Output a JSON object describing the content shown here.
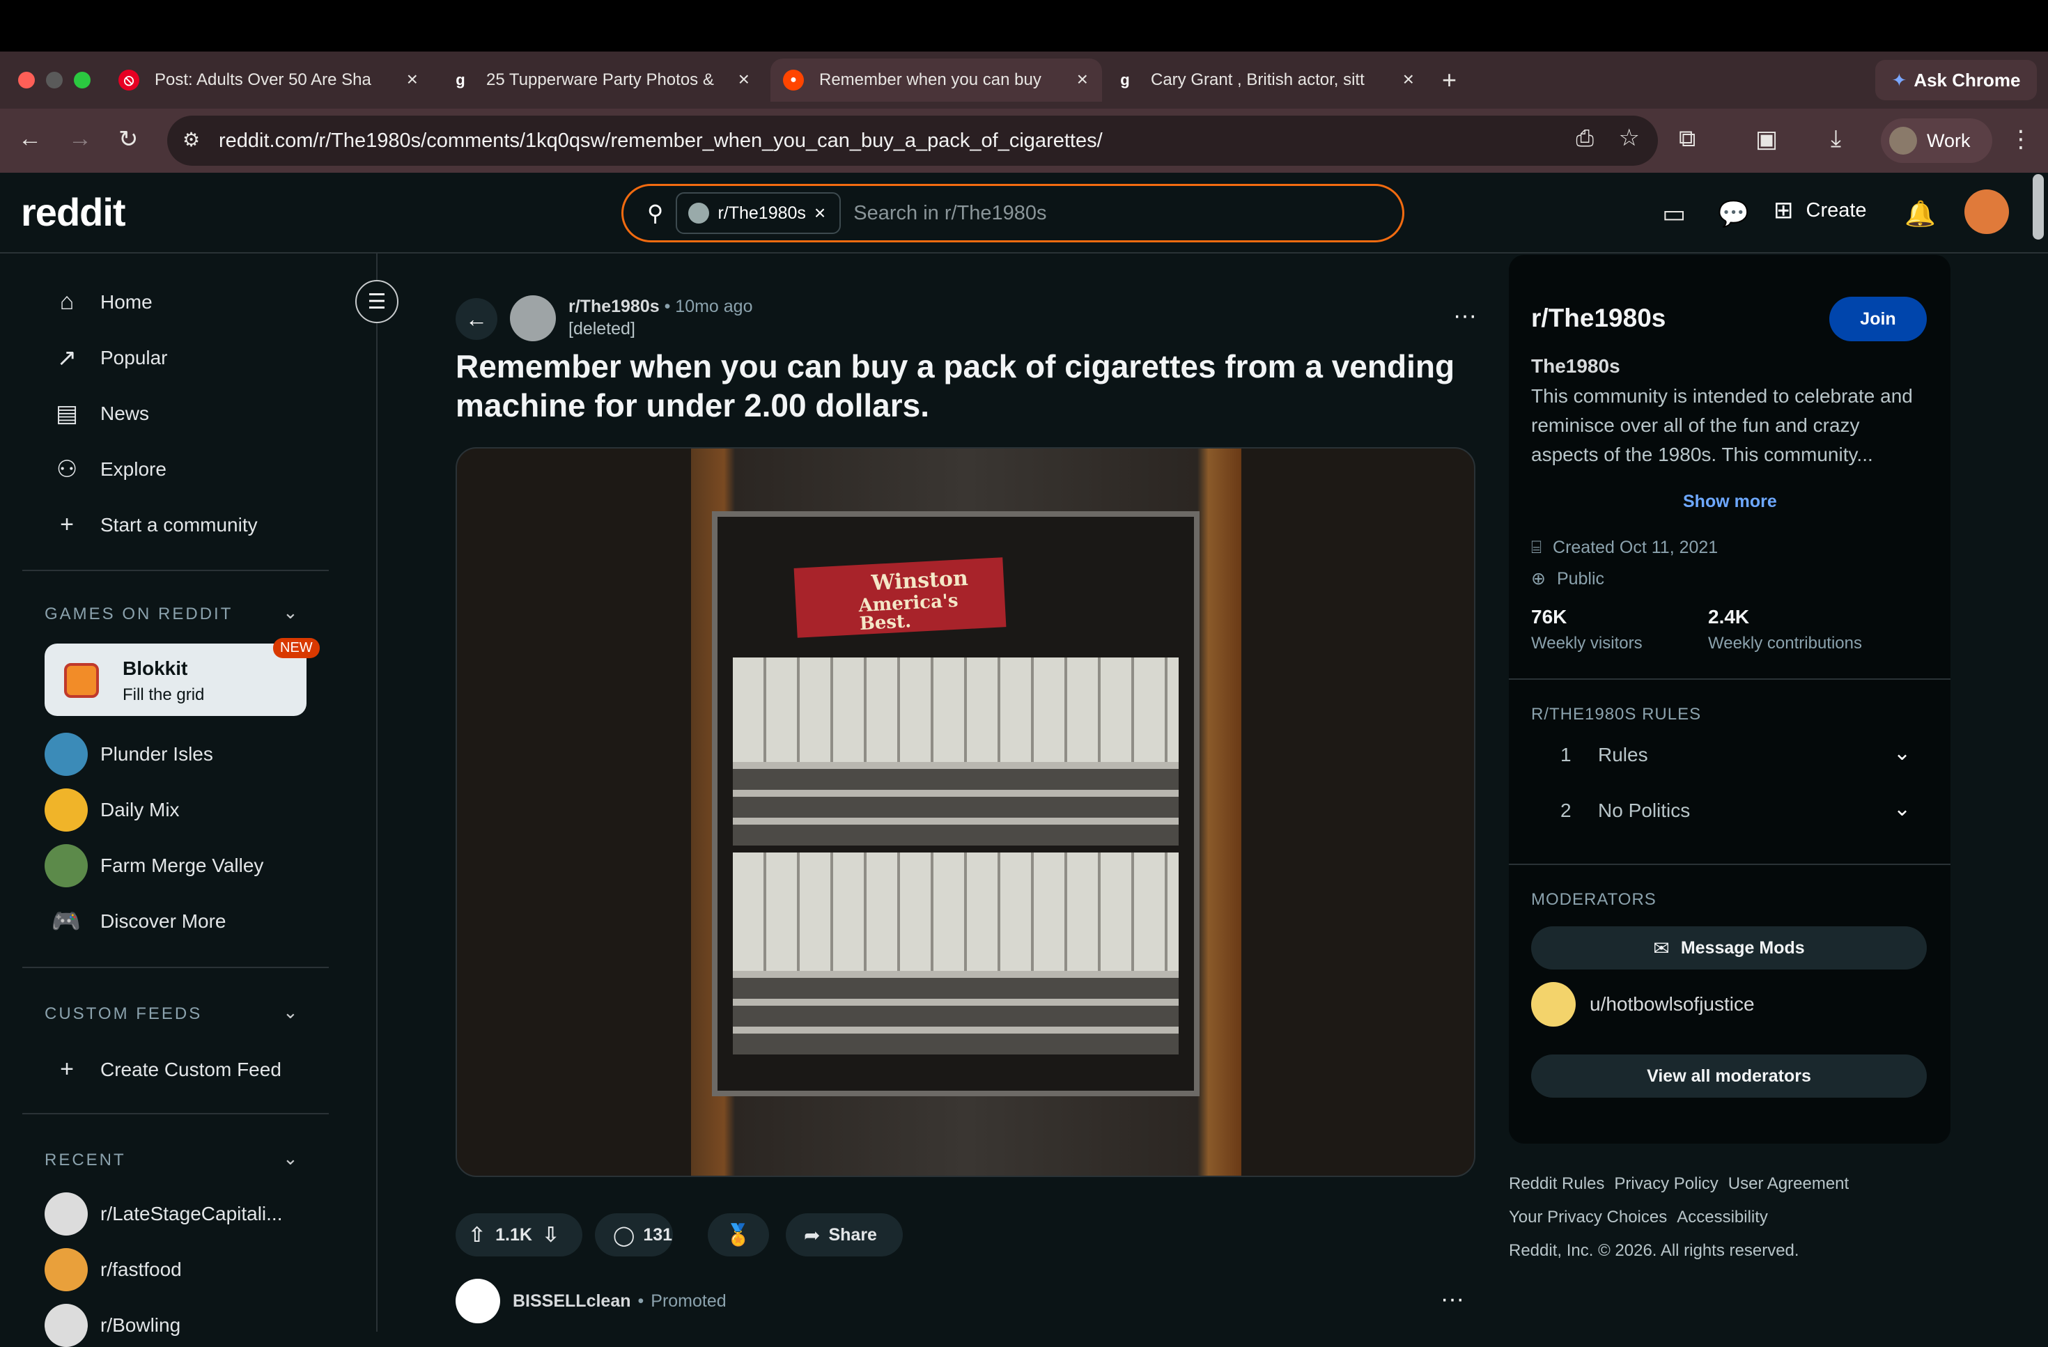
{
  "browser": {
    "tabs": [
      {
        "title": "Post: Adults Over 50 Are Sha",
        "favicon": "pinterest-icon"
      },
      {
        "title": "25 Tupperware Party Photos &",
        "favicon": "g-icon"
      },
      {
        "title": "Remember when you can buy",
        "favicon": "reddit-icon"
      },
      {
        "title": "Cary Grant , British actor, sitt",
        "favicon": "g-icon"
      }
    ],
    "new_tab": "+",
    "ask_chrome": "Ask Chrome",
    "url": "reddit.com/r/The1980s/comments/1kq0qsw/remember_when_you_can_buy_a_pack_of_cigarettes/",
    "profile": "Work"
  },
  "header": {
    "logo": "reddit",
    "search_chip": "r/The1980s",
    "search_placeholder": "Search in r/The1980s",
    "create": "Create"
  },
  "sidebar": {
    "nav": [
      {
        "label": "Home",
        "icon": "home-icon",
        "glyph": "⌂"
      },
      {
        "label": "Popular",
        "icon": "popular-icon",
        "glyph": "↗"
      },
      {
        "label": "News",
        "icon": "news-icon",
        "glyph": "▤"
      },
      {
        "label": "Explore",
        "icon": "explore-icon",
        "glyph": "⚇"
      },
      {
        "label": "Start a community",
        "icon": "plus-icon",
        "glyph": "+"
      }
    ],
    "games_header": "GAMES ON REDDIT",
    "blokkit": {
      "title": "Blokkit",
      "subtitle": "Fill the grid",
      "badge": "NEW"
    },
    "games": [
      "Plunder Isles",
      "Daily Mix",
      "Farm Merge Valley",
      "Discover More"
    ],
    "custom_header": "CUSTOM FEEDS",
    "create_feed": "Create Custom Feed",
    "recent_header": "RECENT",
    "recent": [
      "r/LateStageCapitali...",
      "r/fastfood",
      "r/Bowling"
    ]
  },
  "post": {
    "subreddit": "r/The1980s",
    "time": "10mo ago",
    "author": "[deleted]",
    "title": "Remember when you can buy a pack of cigarettes from a vending machine for under 2.00 dollars.",
    "image_text": {
      "brand": "Winston",
      "slogan": "America's Best."
    },
    "votes": "1.1K",
    "comments": "131",
    "share": "Share"
  },
  "promoted": {
    "name": "BISSELLclean",
    "label": "Promoted"
  },
  "community": {
    "name": "r/The1980s",
    "join": "Join",
    "title": "The1980s",
    "description": "This community is intended to celebrate and reminisce over all of the fun and crazy aspects of the 1980s. This community...",
    "show_more": "Show more",
    "created": "Created Oct 11, 2021",
    "visibility": "Public",
    "stats": [
      {
        "value": "76K",
        "label": "Weekly visitors"
      },
      {
        "value": "2.4K",
        "label": "Weekly contributions"
      }
    ],
    "rules_header": "R/THE1980S RULES",
    "rules": [
      {
        "num": "1",
        "label": "Rules"
      },
      {
        "num": "2",
        "label": "No Politics"
      }
    ],
    "mods_header": "MODERATORS",
    "message_mods": "Message Mods",
    "moderator": "u/hotbowlsofjustice",
    "view_all": "View all moderators"
  },
  "footer": {
    "links": [
      "Reddit Rules",
      "Privacy Policy",
      "User Agreement",
      "Your Privacy Choices",
      "Accessibility"
    ],
    "copyright": "Reddit, Inc. © 2026. All rights reserved."
  },
  "colors": {
    "accent": "#f26b10",
    "join": "#0045ac"
  }
}
